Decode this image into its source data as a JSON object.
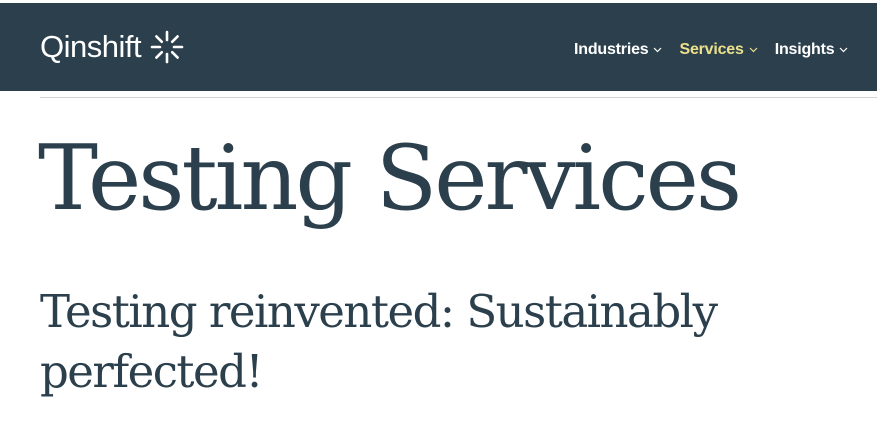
{
  "header": {
    "logo_text": "Qinshift",
    "logo_icon": "spark-burst-icon",
    "background_color": "#2b3f4c",
    "accent_color": "#ece08a",
    "nav": [
      {
        "label": "Industries",
        "active": false
      },
      {
        "label": "Services",
        "active": true
      },
      {
        "label": "Insights",
        "active": false
      }
    ]
  },
  "main": {
    "title": "Testing Services",
    "subtitle": "Testing reinvented: Sustainably perfected!",
    "text_color": "#2b3f4c"
  }
}
